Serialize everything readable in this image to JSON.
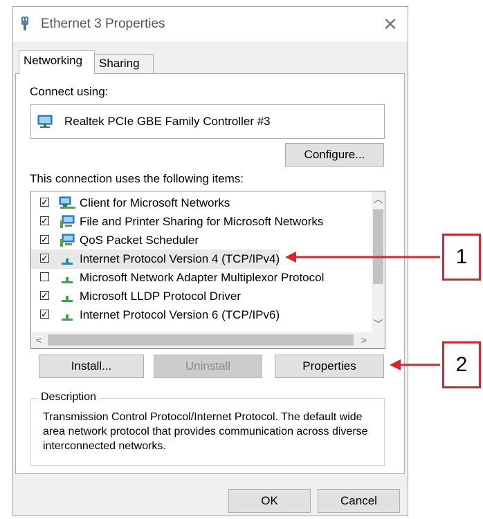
{
  "window": {
    "title": "Ethernet 3 Properties",
    "close_glyph": "✕"
  },
  "tabs": [
    {
      "label": "Networking",
      "active": true
    },
    {
      "label": "Sharing",
      "active": false
    }
  ],
  "connect_using": {
    "label": "Connect using:",
    "adapter_name": "Realtek PCIe GBE Family Controller #3",
    "adapter_icon": "network-adapter-icon"
  },
  "configure_label": "Configure...",
  "items_label": "This connection uses the following items:",
  "items": [
    {
      "label": "Client for Microsoft Networks",
      "checked": true,
      "icon": "network-client-icon"
    },
    {
      "label": "File and Printer Sharing for Microsoft Networks",
      "checked": true,
      "icon": "network-service-icon"
    },
    {
      "label": "QoS Packet Scheduler",
      "checked": true,
      "icon": "network-service-icon"
    },
    {
      "label": "Internet Protocol Version 4 (TCP/IPv4)",
      "checked": true,
      "icon": "protocol-icon",
      "selected": true
    },
    {
      "label": "Microsoft Network Adapter Multiplexor Protocol",
      "checked": false,
      "icon": "protocol-icon"
    },
    {
      "label": "Microsoft LLDP Protocol Driver",
      "checked": true,
      "icon": "protocol-icon"
    },
    {
      "label": "Internet Protocol Version 6 (TCP/IPv6)",
      "checked": true,
      "icon": "protocol-icon"
    }
  ],
  "buttons": {
    "install": "Install...",
    "uninstall": "Uninstall",
    "properties": "Properties",
    "ok": "OK",
    "cancel": "Cancel"
  },
  "description": {
    "legend": "Description",
    "text": "Transmission Control Protocol/Internet Protocol. The default wide area network protocol that provides communication across diverse interconnected networks."
  },
  "callouts": [
    "1",
    "2"
  ],
  "colors": {
    "accent_red": "#d9252a",
    "selection": "#e8e8e8",
    "window_bg": "#f0f0f0"
  }
}
